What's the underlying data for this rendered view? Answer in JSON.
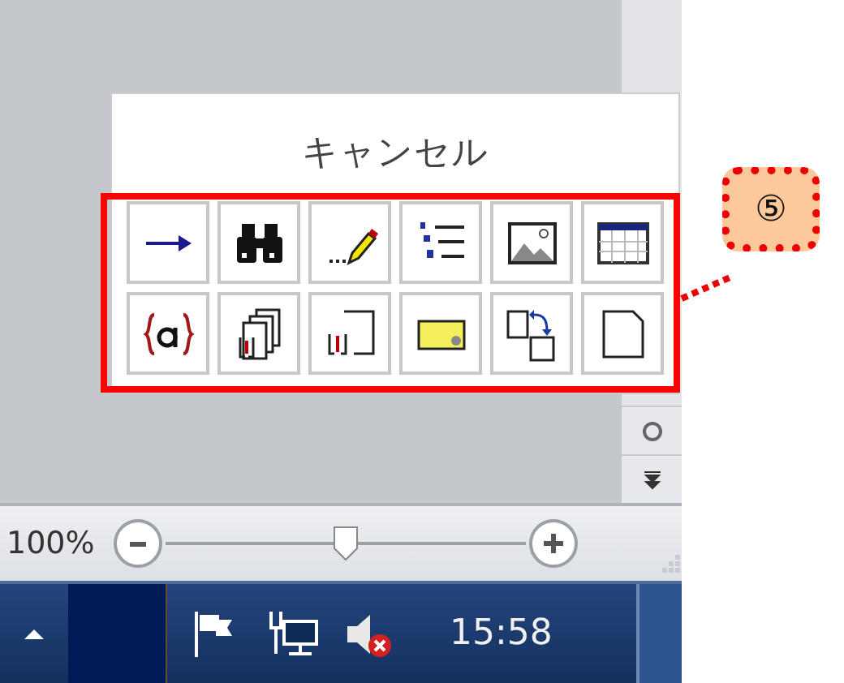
{
  "browse_menu": {
    "cancel_label": "キャンセル",
    "buttons": [
      {
        "kind": "go-to"
      },
      {
        "kind": "find"
      },
      {
        "kind": "edits"
      },
      {
        "kind": "heading"
      },
      {
        "kind": "graphic"
      },
      {
        "kind": "table"
      },
      {
        "kind": "field"
      },
      {
        "kind": "endnote"
      },
      {
        "kind": "footnote"
      },
      {
        "kind": "comment"
      },
      {
        "kind": "section"
      },
      {
        "kind": "page"
      }
    ]
  },
  "status_bar": {
    "zoom_label": "100%",
    "zoom": {
      "level": 0.5
    }
  },
  "taskbar": {
    "clock": "15:58"
  },
  "callout": {
    "label": "⑤"
  }
}
